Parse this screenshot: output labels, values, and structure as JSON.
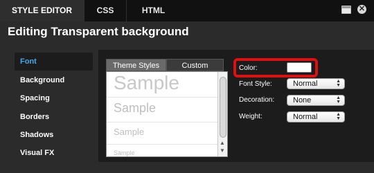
{
  "tabs": [
    {
      "label": "STYLE EDITOR",
      "active": true
    },
    {
      "label": "CSS",
      "active": false
    },
    {
      "label": "HTML",
      "active": false
    }
  ],
  "window_icons": [
    "window-icon",
    "close-icon"
  ],
  "page_title": "Editing Transparent background",
  "sidebar": {
    "items": [
      {
        "label": "Font",
        "active": true
      },
      {
        "label": "Background",
        "active": false
      },
      {
        "label": "Spacing",
        "active": false
      },
      {
        "label": "Borders",
        "active": false
      },
      {
        "label": "Shadows",
        "active": false
      },
      {
        "label": "Visual FX",
        "active": false
      }
    ]
  },
  "style_list": {
    "tabs": [
      {
        "label": "Theme Styles",
        "active": true
      },
      {
        "label": "Custom",
        "active": false
      }
    ],
    "samples": [
      "Sample",
      "Sample",
      "Sample",
      "Sample"
    ]
  },
  "properties": {
    "color": {
      "label": "Color:",
      "value": "#ffffff"
    },
    "font_style": {
      "label": "Font Style:",
      "value": "Normal"
    },
    "decoration": {
      "label": "Decoration:",
      "value": "None"
    },
    "weight": {
      "label": "Weight:",
      "value": "Normal"
    }
  },
  "colors": {
    "accent": "#4aa8ec",
    "highlight": "#e01010"
  }
}
